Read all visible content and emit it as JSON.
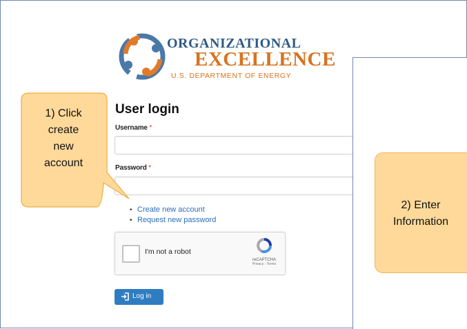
{
  "logo": {
    "line1": "ORGANIZATIONAL",
    "line2": "EXCELLENCE",
    "line3": "U.S. DEPARTMENT OF ENERGY",
    "ring_text": "ORGANIZATIONAL EXCELLENCE",
    "colors": {
      "blue": "#2e5a85",
      "orange": "#d8731f",
      "ring_blue": "#4a78a8",
      "ring_orange": "#e07b2a"
    }
  },
  "login": {
    "heading": "User login",
    "username_label": "Username",
    "password_label": "Password",
    "required_marker": "*",
    "links": [
      "Create new account",
      "Request new password"
    ],
    "captcha_label": "I'm not a robot",
    "captcha_brand": "reCAPTCHA",
    "captcha_footer": "Privacy - Terms",
    "login_button": "Log in"
  },
  "callouts": {
    "step1_lines": [
      "1) Click",
      "create",
      "new",
      "account"
    ],
    "step2_lines": [
      "2) Enter",
      "Information"
    ]
  },
  "colors": {
    "accent": "#2f7dc1",
    "callout_fill": "#ffd99a",
    "callout_border": "#efb756",
    "frame_border": "#6f86b6"
  }
}
